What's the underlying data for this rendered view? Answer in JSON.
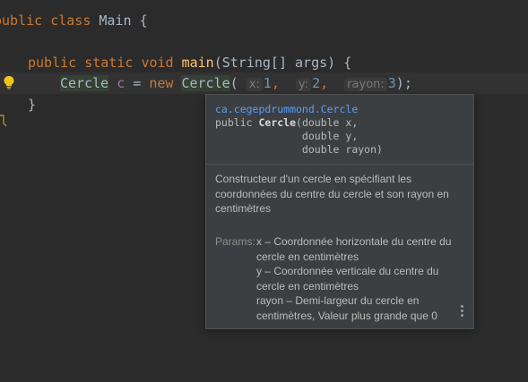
{
  "editor": {
    "line1": {
      "kw_public": "public",
      "kw_class": "class",
      "class_name": "Main",
      "brace": "{"
    },
    "line2": {
      "kw_public": "public",
      "kw_static": "static",
      "kw_void": "void",
      "method": "main",
      "sig_rest": "(String[] args) {"
    },
    "line3": {
      "type": "Cercle",
      "var": "c",
      "assign": "=",
      "kw_new": "new",
      "ctor": "Cercle",
      "open": "(",
      "hint_x": "x:",
      "val_x": "1",
      "hint_y": "y:",
      "val_y": "2",
      "hint_rayon": "rayon:",
      "val_rayon": "3",
      "close": ");"
    },
    "line4": {
      "brace": "}"
    },
    "line5": {
      "brace": "}"
    }
  },
  "popup": {
    "package": "ca.cegepdrummond.Cercle",
    "sig_prefix": "public ",
    "sig_name": "Cercle",
    "sig_line1_rest": "(double x,",
    "sig_line2": "              double y,",
    "sig_line3": "              double rayon)",
    "description": "Constructeur d'un cercle en spécifiant les coordonnées du centre du cercle et son rayon en centimètres",
    "params_label": "Params:",
    "params": [
      "x – Coordonnée horizontale du centre du cercle en centimètres",
      "y – Coordonnée verticale du centre du cercle en centimètres",
      "rayon – Demi-largeur du cercle en centimètres, Valeur plus grande que 0"
    ]
  },
  "icons": {
    "bulb": "lightbulb-icon",
    "more": "more-vertical-icon",
    "gutter": "fold-marker-icon"
  },
  "colors": {
    "background": "#2b2b2b",
    "keyword": "#cc7832",
    "method": "#ffc66d",
    "number": "#6897bb",
    "link": "#589df6",
    "popup_bg": "#3c3f41"
  }
}
